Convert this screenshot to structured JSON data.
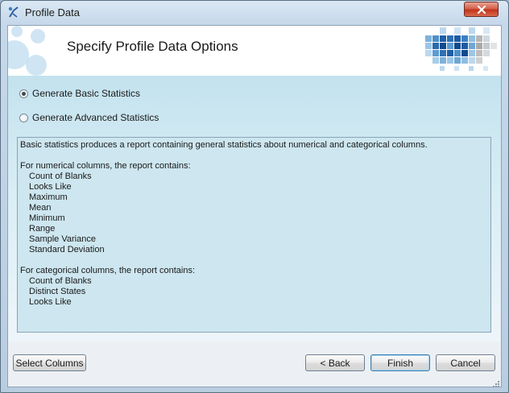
{
  "window": {
    "title": "Profile Data",
    "app_icon": "wizard-icon",
    "close_icon": "close-icon"
  },
  "header": {
    "title": "Specify Profile Data Options",
    "logo": "mosaic-logo"
  },
  "options": [
    {
      "label": "Generate Basic Statistics",
      "selected": true
    },
    {
      "label": "Generate Advanced Statistics",
      "selected": false
    }
  ],
  "description": {
    "intro": "Basic statistics produces a report containing general statistics about numerical and categorical columns.",
    "numerical_heading": "For numerical columns, the report contains:",
    "numerical_items": [
      "Count of Blanks",
      "Looks Like",
      "Maximum",
      "Mean",
      "Minimum",
      "Range",
      "Sample Variance",
      "Standard Deviation"
    ],
    "categorical_heading": "For categorical columns, the report contains:",
    "categorical_items": [
      "Count of Blanks",
      "Distinct States",
      "Looks Like"
    ]
  },
  "buttons": {
    "select_columns": "Select Columns",
    "back": "< Back",
    "finish": "Finish",
    "cancel": "Cancel"
  },
  "colors": {
    "accent_blue": "#3a7fc4",
    "close_red": "#c2341b",
    "content_bg": "#cde6ef"
  }
}
